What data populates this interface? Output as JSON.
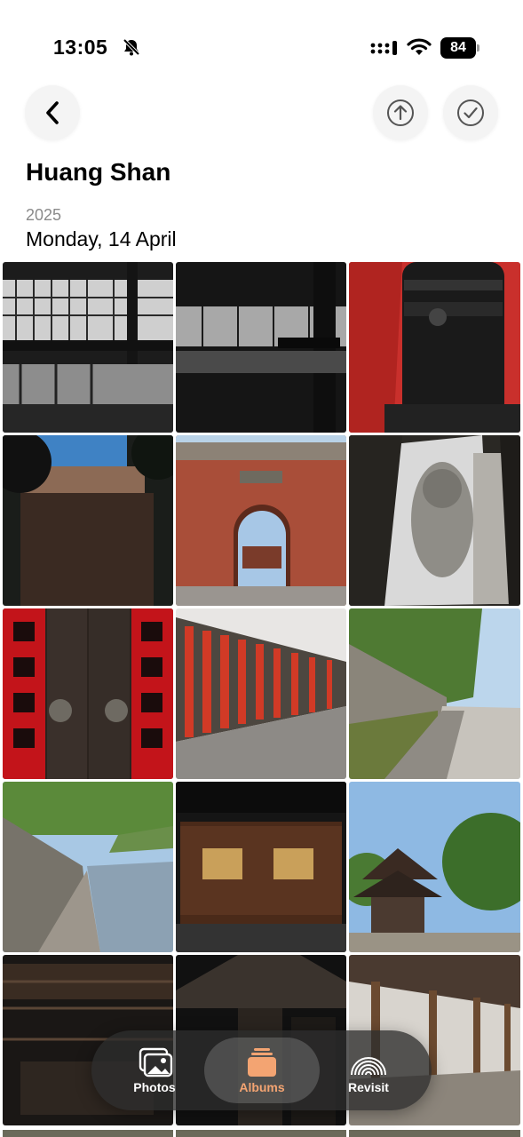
{
  "status_bar": {
    "time": "13:05",
    "battery": "84"
  },
  "album": {
    "title": "Huang Shan",
    "year": "2025",
    "date": "Monday, 14 April"
  },
  "photos": [
    {
      "subject": "terminal-hall-silhouettes"
    },
    {
      "subject": "terminal-window-reflection"
    },
    {
      "subject": "sony-camera-lens"
    },
    {
      "subject": "brick-wall-through-trees"
    },
    {
      "subject": "city-gate-arch"
    },
    {
      "subject": "stone-lion-statue"
    },
    {
      "subject": "red-couplets-door"
    },
    {
      "subject": "red-banners-wall"
    },
    {
      "subject": "riverside-wall-path"
    },
    {
      "subject": "river-stone-path"
    },
    {
      "subject": "wooden-plaque"
    },
    {
      "subject": "pavilion-trees"
    },
    {
      "subject": "wooden-ceiling"
    },
    {
      "subject": "covered-bridge-roof"
    },
    {
      "subject": "wooden-corridor"
    }
  ],
  "tabbar": {
    "tabs": [
      {
        "label": "Photos",
        "icon": "photos-icon"
      },
      {
        "label": "Albums",
        "icon": "albums-icon",
        "selected": true
      },
      {
        "label": "Revisit",
        "icon": "revisit-icon"
      }
    ],
    "accent_color": "#f3a472"
  }
}
